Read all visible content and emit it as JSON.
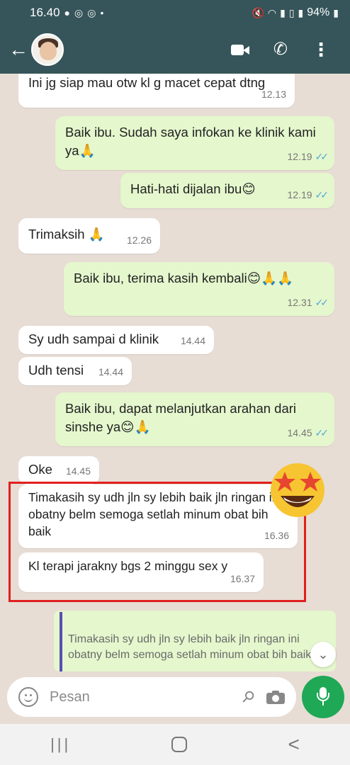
{
  "status_bar": {
    "time": "16.40",
    "left_icons": [
      "chat-notification-icon",
      "whatsapp-icon",
      "whatsapp-icon",
      "dot-icon"
    ],
    "right_icons": [
      "mute-icon",
      "wifi-icon",
      "signal-icon",
      "volte-icon",
      "signal-icon"
    ],
    "battery": "94%"
  },
  "header": {
    "back_icon": "arrow-left",
    "actions": [
      "video-call-icon",
      "phone-icon",
      "more-vert-icon"
    ]
  },
  "messages": [
    {
      "dir": "in",
      "text": "Ini jg siap mau otw kl g macet cepat dtng",
      "time": "12.13"
    },
    {
      "dir": "out",
      "text": "Baik ibu. Sudah saya infokan ke klinik kami ya🙏",
      "time": "12.19",
      "read": true
    },
    {
      "dir": "out",
      "text": "Hati-hati dijalan ibu😊",
      "time": "12.19",
      "read": true
    },
    {
      "dir": "in",
      "text": "Trimaksih 🙏",
      "time": "12.26"
    },
    {
      "dir": "out",
      "text": "Baik ibu, terima kasih kembali😊🙏🙏",
      "time": "12.31",
      "read": true
    },
    {
      "dir": "in",
      "text": "Sy udh sampai d klinik",
      "time": "14.44"
    },
    {
      "dir": "in",
      "text": "Udh tensi",
      "time": "14.44"
    },
    {
      "dir": "out",
      "text": "Baik ibu, dapat melanjutkan arahan dari sinshe ya😊🙏",
      "time": "14.45",
      "read": true
    },
    {
      "dir": "in",
      "text": "Oke",
      "time": "14.45"
    },
    {
      "dir": "in",
      "text": "Timakasih sy udh jln sy lebih baik jln ringan ini obatny belm semoga setlah minum obat bih baik",
      "time": "16.36"
    },
    {
      "dir": "in",
      "text": "Kl terapi jarakny bgs 2 minggu sex y",
      "time": "16.37"
    }
  ],
  "reply_preview": {
    "text": "Timakasih sy udh jln sy lebih baik jln ringan ini obatny belm semoga setlah minum obat bih baik"
  },
  "composer": {
    "placeholder": "Pesan"
  },
  "nav": {
    "recents": "|||",
    "back": "<"
  }
}
